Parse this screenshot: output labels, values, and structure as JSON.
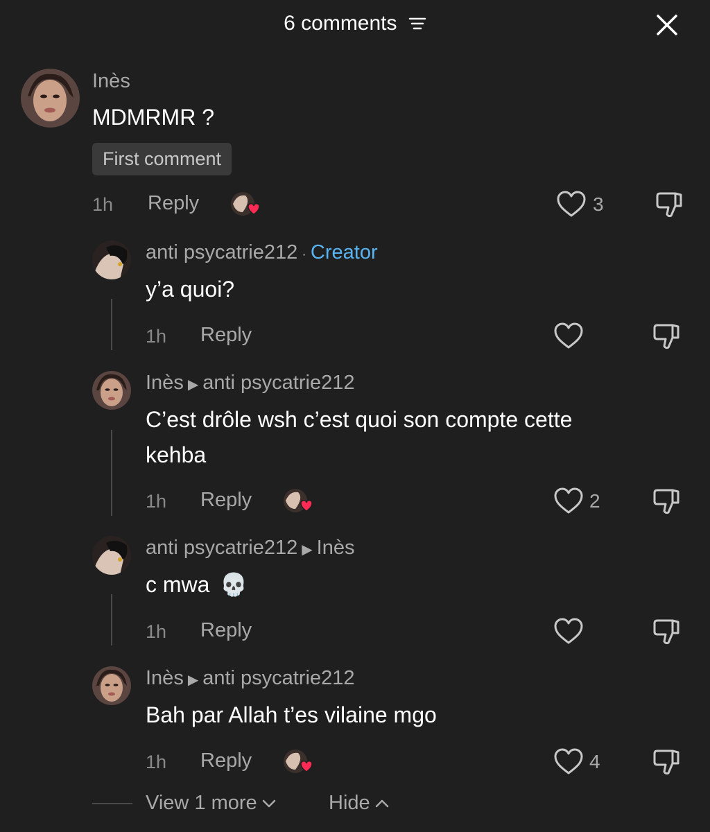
{
  "header": {
    "count_label": "6 comments"
  },
  "comments": [
    {
      "user": "Inès",
      "text": "MDMRMR ?",
      "badge": "First comment",
      "time": "1h",
      "reply": "Reply",
      "likes": "3"
    },
    {
      "user": "anti psycatrie212",
      "creator_label": "Creator",
      "text": "y’a quoi?",
      "time": "1h",
      "reply": "Reply"
    },
    {
      "user": "Inès",
      "reply_to": "anti psycatrie212",
      "text_line1": "C’est drôle wsh c’est quoi son compte cette",
      "text_line2": "kehba",
      "time": "1h",
      "reply": "Reply",
      "likes": "2"
    },
    {
      "user": "anti psycatrie212",
      "reply_to": "Inès",
      "text": "c mwa",
      "emoji": "💀",
      "time": "1h",
      "reply": "Reply"
    },
    {
      "user": "Inès",
      "reply_to": "anti psycatrie212",
      "text": "Bah par Allah t’es vilaine mgo",
      "time": "1h",
      "reply": "Reply",
      "likes": "4"
    }
  ],
  "footer": {
    "view_more": "View 1 more",
    "hide": "Hide"
  },
  "colors": {
    "background": "#1f1f1f",
    "creator": "#58b3f0",
    "heart": "#ff2b55"
  }
}
